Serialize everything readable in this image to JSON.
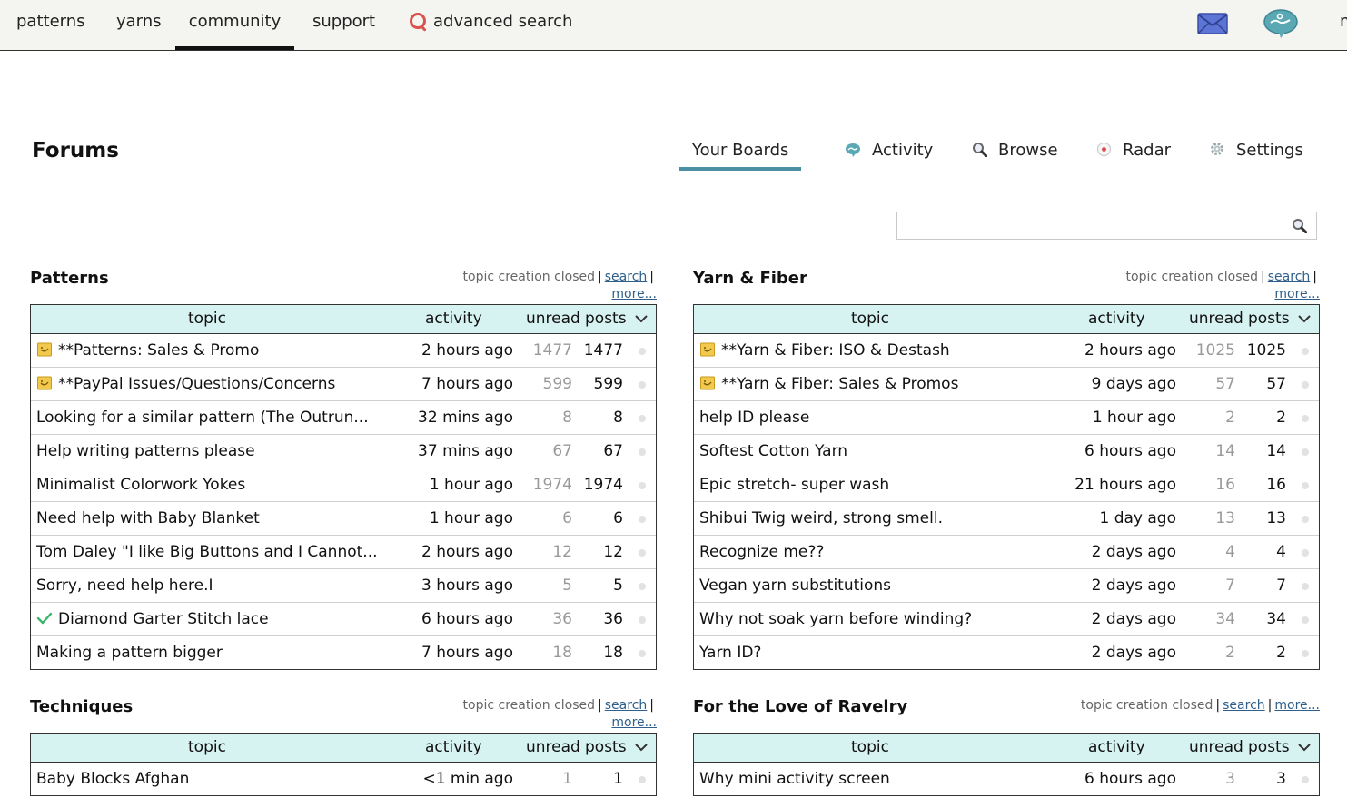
{
  "nav": {
    "items": [
      "patterns",
      "yarns",
      "community",
      "support",
      "advanced search"
    ],
    "active": "community",
    "cut_text": "m"
  },
  "forums": {
    "title": "Forums",
    "tabs": [
      "Your Boards",
      "Activity",
      "Browse",
      "Radar",
      "Settings"
    ],
    "active_tab": "Your Boards",
    "search_placeholder": ""
  },
  "columns": {
    "topic": "topic",
    "activity": "activity",
    "unread": "unread",
    "posts": "posts"
  },
  "boards": [
    {
      "title": "Patterns",
      "meta": {
        "closed": "topic creation closed",
        "search": "search",
        "more": "more..."
      },
      "rows": [
        {
          "topic": "**Patterns: Sales & Promo",
          "icon": "sticky",
          "activity": "2 hours ago",
          "unread": "1477",
          "posts": "1477"
        },
        {
          "topic": "**PayPal Issues/Questions/Concerns",
          "icon": "sticky",
          "activity": "7 hours ago",
          "unread": "599",
          "posts": "599"
        },
        {
          "topic": "Looking for a similar pattern (The Outrun...",
          "icon": "",
          "activity": "32 mins ago",
          "unread": "8",
          "posts": "8"
        },
        {
          "topic": "Help writing patterns please",
          "icon": "",
          "activity": "37 mins ago",
          "unread": "67",
          "posts": "67"
        },
        {
          "topic": "Minimalist Colorwork Yokes",
          "icon": "",
          "activity": "1 hour ago",
          "unread": "1974",
          "posts": "1974"
        },
        {
          "topic": "Need help with Baby Blanket",
          "icon": "",
          "activity": "1 hour ago",
          "unread": "6",
          "posts": "6"
        },
        {
          "topic": "Tom Daley \"I like Big Buttons and I Cannot...",
          "icon": "",
          "activity": "2 hours ago",
          "unread": "12",
          "posts": "12"
        },
        {
          "topic": "Sorry, need help here.I",
          "icon": "",
          "activity": "3 hours ago",
          "unread": "5",
          "posts": "5"
        },
        {
          "topic": "Diamond Garter Stitch lace",
          "icon": "check",
          "activity": "6 hours ago",
          "unread": "36",
          "posts": "36"
        },
        {
          "topic": "Making a pattern bigger",
          "icon": "",
          "activity": "7 hours ago",
          "unread": "18",
          "posts": "18"
        }
      ]
    },
    {
      "title": "Yarn & Fiber",
      "meta": {
        "closed": "topic creation closed",
        "search": "search",
        "more": "more..."
      },
      "rows": [
        {
          "topic": "**Yarn & Fiber: ISO & Destash",
          "icon": "sticky",
          "activity": "2 hours ago",
          "unread": "1025",
          "posts": "1025"
        },
        {
          "topic": "**Yarn & Fiber: Sales & Promos",
          "icon": "sticky",
          "activity": "9 days ago",
          "unread": "57",
          "posts": "57"
        },
        {
          "topic": "help ID please",
          "icon": "",
          "activity": "1 hour ago",
          "unread": "2",
          "posts": "2"
        },
        {
          "topic": "Softest Cotton Yarn",
          "icon": "",
          "activity": "6 hours ago",
          "unread": "14",
          "posts": "14"
        },
        {
          "topic": "Epic stretch- super wash",
          "icon": "",
          "activity": "21 hours ago",
          "unread": "16",
          "posts": "16"
        },
        {
          "topic": "Shibui Twig weird, strong smell.",
          "icon": "",
          "activity": "1 day ago",
          "unread": "13",
          "posts": "13"
        },
        {
          "topic": "Recognize me??",
          "icon": "",
          "activity": "2 days ago",
          "unread": "4",
          "posts": "4"
        },
        {
          "topic": "Vegan yarn substitutions",
          "icon": "",
          "activity": "2 days ago",
          "unread": "7",
          "posts": "7"
        },
        {
          "topic": "Why not soak yarn before winding?",
          "icon": "",
          "activity": "2 days ago",
          "unread": "34",
          "posts": "34"
        },
        {
          "topic": "Yarn ID?",
          "icon": "",
          "activity": "2 days ago",
          "unread": "2",
          "posts": "2"
        }
      ]
    },
    {
      "title": "Techniques",
      "meta": {
        "closed": "topic creation closed",
        "search": "search",
        "more": "more..."
      },
      "rows": [
        {
          "topic": "Baby Blocks Afghan",
          "icon": "",
          "activity": "<1 min ago",
          "unread": "1",
          "posts": "1"
        }
      ]
    },
    {
      "title": "For the Love of Ravelry",
      "meta": {
        "closed": "topic creation closed",
        "search": "search",
        "more": "more..."
      },
      "rows": [
        {
          "topic": "Why mini activity screen",
          "icon": "",
          "activity": "6 hours ago",
          "unread": "3",
          "posts": "3"
        }
      ]
    }
  ],
  "colors": {
    "header_bg": "#d7f3f1",
    "accent": "#4a8fa3",
    "nav_bg": "#f4f4f1",
    "link": "#2f5f8a"
  }
}
